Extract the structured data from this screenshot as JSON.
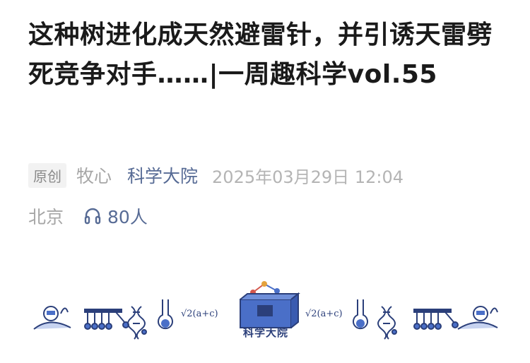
{
  "article": {
    "title": "这种树进化成天然避雷针，并引诱天雷劈死竞争对手……|一周趣科学vol.55"
  },
  "meta": {
    "original_tag": "原创",
    "author": "牧心",
    "account": "科学大院",
    "datetime": "2025年03月29日 12:04",
    "location": "北京",
    "listen_icon": "headphones-icon",
    "listen_count": "80人"
  },
  "banner": {
    "brand_text": "科学大院",
    "formula_left": "√2(a+c)",
    "formula_right": "√2(a+c)",
    "accent_color": "#4a6fc8",
    "line_color": "#2b3f7a"
  }
}
